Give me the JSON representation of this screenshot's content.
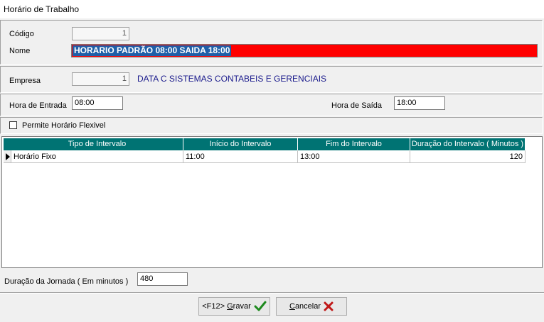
{
  "window": {
    "title": "Horário de Trabalho"
  },
  "form": {
    "codigo_label": "Código",
    "codigo_value": "1",
    "nome_label": "Nome",
    "nome_value": "HORARIO PADRÃO 08:00 SAIDA 18:00",
    "empresa_label": "Empresa",
    "empresa_code": "1",
    "empresa_name": "DATA C SISTEMAS CONTABEIS E GERENCIAIS",
    "hora_entrada_label": "Hora de Entrada",
    "hora_entrada_value": "08:00",
    "hora_saida_label": "Hora de Saída",
    "hora_saida_value": "18:00",
    "flexivel_label": "Permite Horário Flexivel",
    "duracao_label": "Duração da Jornada ( Em minutos )",
    "duracao_value": "480"
  },
  "grid": {
    "headers": [
      "Tipo de Intervalo",
      "Início do Intervalo",
      "Fim do Intervalo",
      "Duração do Intervalo ( Minutos )"
    ],
    "rows": [
      [
        "Horário Fixo",
        "11:00",
        "13:00",
        "120"
      ]
    ]
  },
  "buttons": {
    "gravar_prefix": "<F12> ",
    "gravar_underlined": "G",
    "gravar_rest": "ravar",
    "cancelar_underlined": "C",
    "cancelar_rest": "ancelar"
  },
  "colors": {
    "nome_bg": "#ff0000",
    "grid_header": "#007373",
    "company_text": "#1a1a8c"
  }
}
